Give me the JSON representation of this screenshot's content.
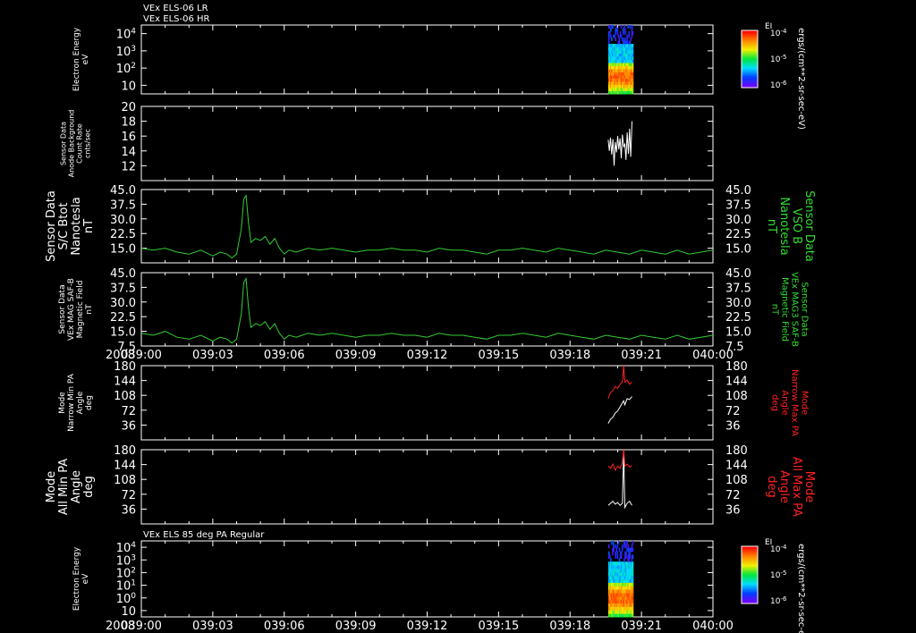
{
  "chart_data": [
    {
      "type": "heatmap",
      "id": "p1",
      "title": "VEx ELS-06 LR",
      "subtitle": "VEx ELS-06 HR",
      "ylabel": "Electron Energy",
      "yunit": "eV",
      "yscale": "log",
      "y_ticks": [
        "10",
        "10^2",
        "10^3",
        "10^4"
      ],
      "colorbar": {
        "label": "EI",
        "ticks": [
          "10^-4",
          "10^-5",
          "10^-6"
        ],
        "title": "ergs/(cm**2-sr-sec-eV)"
      },
      "data_time_range": [
        "039:19.6",
        "039:20.6"
      ]
    },
    {
      "type": "line",
      "id": "p2",
      "ylabel": "Sensor Data",
      "ylabel2": "Anode Background",
      "ylabel3": "Count Rate",
      "yunit": "cnts/sec",
      "ylim": [
        10,
        20
      ],
      "y_ticks": [
        "12",
        "14",
        "16",
        "18",
        "20"
      ],
      "series": [
        {
          "color": "#ffffff",
          "x": [
            19.6,
            19.65,
            19.7,
            19.75,
            19.8,
            19.85,
            19.9,
            19.95,
            20.0,
            20.05,
            20.1,
            20.15,
            20.2,
            20.25,
            20.3,
            20.35,
            20.4,
            20.45,
            20.5,
            20.55,
            20.6
          ],
          "values": [
            15.5,
            14.0,
            15.8,
            13.5,
            15.6,
            12.0,
            15.2,
            13.8,
            16.0,
            14.2,
            15.7,
            13.0,
            16.2,
            14.5,
            15.0,
            12.8,
            16.5,
            13.6,
            17.0,
            13.2,
            18.0
          ]
        }
      ]
    },
    {
      "type": "line",
      "id": "p3",
      "ylabel": "Sensor Data",
      "ylabel2": "S/C Btot",
      "ylabel3": "Nanotesla",
      "yunit": "nT",
      "right_label": "Sensor Data",
      "right_label2": "VSO B",
      "right_label3": "Nanotesla",
      "right_unit": "nT",
      "ylim": [
        7.5,
        45
      ],
      "y_ticks": [
        "15.0",
        "22.5",
        "30.0",
        "37.5",
        "45.0"
      ],
      "series": [
        {
          "color": "#33cc33",
          "x": [
            0,
            0.5,
            1.0,
            1.5,
            2.0,
            2.5,
            3.0,
            3.3,
            3.6,
            3.8,
            4.0,
            4.2,
            4.3,
            4.4,
            4.5,
            4.6,
            4.8,
            5.0,
            5.2,
            5.4,
            5.6,
            5.8,
            6.0,
            6.2,
            6.5,
            7.0,
            7.5,
            8.0,
            8.5,
            9.0,
            9.5,
            10.0,
            10.5,
            11.0,
            11.5,
            12.0,
            12.5,
            13.0,
            13.5,
            14.0,
            14.5,
            15.0,
            15.5,
            16.0,
            16.5,
            17.0,
            17.5,
            18.0,
            18.5,
            19.0,
            19.5,
            20.0,
            20.5,
            21.0,
            21.5,
            22.0,
            22.5,
            23.0,
            23.5,
            24.0
          ],
          "values": [
            15,
            14,
            15,
            13,
            12,
            14,
            11,
            13,
            12,
            10,
            12,
            25,
            40,
            42,
            28,
            18,
            20,
            19,
            21,
            17,
            20,
            15,
            12,
            14,
            13,
            15,
            14,
            15,
            14,
            13,
            14,
            14,
            15,
            14,
            14,
            13,
            15,
            14,
            14,
            13,
            12,
            14,
            14,
            15,
            14,
            13,
            15,
            14,
            13,
            12,
            14,
            13,
            12,
            14,
            13,
            12,
            14,
            12,
            13,
            14
          ]
        }
      ]
    },
    {
      "type": "line",
      "id": "p4",
      "ylabel": "Sensor Data",
      "ylabel2": "VEx MAG SAF-B",
      "ylabel3": "Magnetic Field",
      "yunit": "nT",
      "right_label": "Sensor Data",
      "right_label2": "VEx MAG3 SAF-B",
      "right_label3": "Magnetic Field",
      "right_unit": "nT",
      "ylim": [
        7.5,
        45
      ],
      "y_ticks": [
        "7.5",
        "15.0",
        "22.5",
        "30.0",
        "37.5",
        "45.0"
      ],
      "series": [
        {
          "color": "#33cc33",
          "x": [
            0,
            0.5,
            1.0,
            1.5,
            2.0,
            2.5,
            3.0,
            3.3,
            3.6,
            3.8,
            4.0,
            4.2,
            4.3,
            4.4,
            4.5,
            4.6,
            4.8,
            5.0,
            5.2,
            5.4,
            5.6,
            5.8,
            6.0,
            6.2,
            6.5,
            7.0,
            7.5,
            8.0,
            8.5,
            9.0,
            9.5,
            10.0,
            10.5,
            11.0,
            11.5,
            12.0,
            12.5,
            13.0,
            13.5,
            14.0,
            14.5,
            15.0,
            15.5,
            16.0,
            16.5,
            17.0,
            17.5,
            18.0,
            18.5,
            19.0,
            19.5,
            20.0,
            20.5,
            21.0,
            21.5,
            22.0,
            22.5,
            23.0,
            23.5,
            24.0
          ],
          "values": [
            14,
            13,
            15,
            12,
            11,
            13,
            10,
            12,
            11,
            9,
            11,
            24,
            40,
            42,
            27,
            17,
            19,
            18,
            20,
            16,
            19,
            14,
            11,
            13,
            12,
            14,
            13,
            14,
            13,
            12,
            13,
            13,
            14,
            13,
            13,
            12,
            14,
            13,
            13,
            12,
            11,
            13,
            13,
            14,
            13,
            12,
            14,
            13,
            12,
            11,
            13,
            12,
            11,
            13,
            12,
            11,
            13,
            11,
            12,
            13
          ]
        }
      ]
    },
    {
      "type": "line",
      "id": "p5",
      "ylabel": "Mode",
      "ylabel2": "Narrow Min PA",
      "ylabel3": "Angle",
      "yunit": "deg",
      "right_label": "Mode",
      "right_label2": "Narrow Max PA",
      "right_label3": "Angle",
      "right_unit": "deg",
      "ylim": [
        0,
        180
      ],
      "y_ticks": [
        "36",
        "72",
        "108",
        "144",
        "180"
      ],
      "series": [
        {
          "color": "#ffffff",
          "x": [
            19.6,
            19.7,
            19.8,
            19.9,
            20.0,
            20.1,
            20.2,
            20.25,
            20.3,
            20.4,
            20.5,
            20.6
          ],
          "values": [
            40,
            50,
            55,
            65,
            70,
            80,
            90,
            95,
            85,
            100,
            98,
            105
          ]
        },
        {
          "color": "#ff2222",
          "x": [
            19.6,
            19.7,
            19.8,
            19.9,
            20.0,
            20.1,
            20.2,
            20.25,
            20.3,
            20.4,
            20.5,
            20.6
          ],
          "values": [
            100,
            115,
            120,
            130,
            125,
            135,
            140,
            180,
            140,
            145,
            135,
            140
          ]
        }
      ]
    },
    {
      "type": "line",
      "id": "p6",
      "ylabel": "Mode",
      "ylabel2": "All Min PA",
      "ylabel3": "Angle",
      "yunit": "deg",
      "right_label": "Mode",
      "right_label2": "All Max PA",
      "right_label3": "Angle",
      "right_unit": "deg",
      "ylim": [
        0,
        180
      ],
      "y_ticks": [
        "36",
        "72",
        "108",
        "144",
        "180"
      ],
      "series": [
        {
          "color": "#ffffff",
          "x": [
            19.6,
            19.7,
            19.8,
            19.9,
            20.0,
            20.1,
            20.2,
            20.25,
            20.3,
            20.4,
            20.5,
            20.6
          ],
          "values": [
            45,
            50,
            55,
            48,
            52,
            45,
            50,
            180,
            40,
            50,
            55,
            45
          ]
        },
        {
          "color": "#ff2222",
          "x": [
            19.6,
            19.7,
            19.8,
            19.9,
            20.0,
            20.1,
            20.2,
            20.25,
            20.3,
            20.4,
            20.5,
            20.6
          ],
          "values": [
            140,
            135,
            145,
            130,
            140,
            135,
            150,
            180,
            140,
            145,
            138,
            142
          ]
        }
      ]
    },
    {
      "type": "heatmap",
      "id": "p7",
      "title": "VEx ELS 85 deg PA Regular",
      "ylabel": "Electron Energy",
      "yunit": "eV",
      "yscale": "log",
      "y_ticks": [
        "10",
        "10^0",
        "10^1",
        "10^2",
        "10^3",
        "10^4"
      ],
      "colorbar": {
        "label": "EI",
        "ticks": [
          "10^-4",
          "10^-5",
          "10^-6"
        ],
        "title": "ergs/(cm**2-sr-sec-eV)"
      },
      "data_time_range": [
        "039:19.6",
        "039:20.6"
      ]
    }
  ],
  "x_axis": {
    "year_label": "2008",
    "tick_labels": [
      "039:00",
      "039:03",
      "039:06",
      "039:09",
      "039:12",
      "039:15",
      "039:18",
      "039:21",
      "040:00"
    ],
    "range_minutes": [
      0,
      24
    ]
  }
}
